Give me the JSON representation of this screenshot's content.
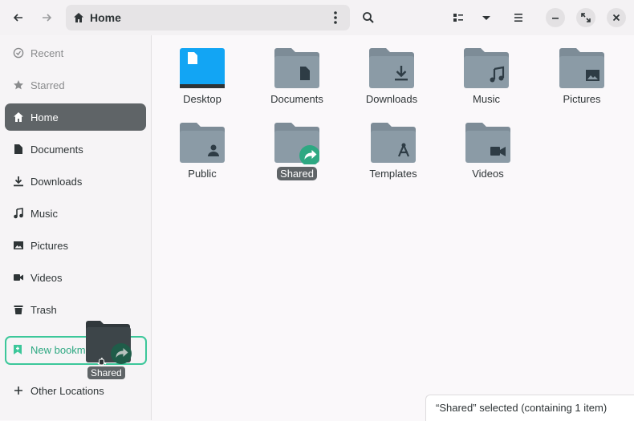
{
  "header": {
    "location": "Home",
    "icons": [
      "back-icon",
      "forward-icon",
      "home-icon",
      "path-menu-icon",
      "search-icon",
      "view-list-icon",
      "sort-dropdown-icon",
      "hamburger-menu-icon",
      "minimize-icon",
      "maximize-icon",
      "close-icon"
    ]
  },
  "sidebar": {
    "items": [
      {
        "label": "Recent",
        "icon": "clock-icon"
      },
      {
        "label": "Starred",
        "icon": "star-icon"
      },
      {
        "label": "Home",
        "icon": "home-icon"
      },
      {
        "label": "Documents",
        "icon": "document-icon"
      },
      {
        "label": "Downloads",
        "icon": "download-icon"
      },
      {
        "label": "Music",
        "icon": "music-icon"
      },
      {
        "label": "Pictures",
        "icon": "picture-icon"
      },
      {
        "label": "Videos",
        "icon": "video-icon"
      },
      {
        "label": "Trash",
        "icon": "trash-icon"
      }
    ],
    "new_bookmark": "New bookm",
    "other_locations": "Other Locations"
  },
  "folders": [
    {
      "label": "Desktop"
    },
    {
      "label": "Documents"
    },
    {
      "label": "Downloads"
    },
    {
      "label": "Music"
    },
    {
      "label": "Pictures"
    },
    {
      "label": "Public"
    },
    {
      "label": "Shared"
    },
    {
      "label": "Templates"
    },
    {
      "label": "Videos"
    }
  ],
  "drag": {
    "label": "Shared"
  },
  "status": {
    "text": "“Shared” selected  (containing 1 item)"
  },
  "colors": {
    "accent": "#3cc79a",
    "folder": "#8b9ba6",
    "folder_back": "#7d8c97",
    "selected": "#5f6467",
    "desktop": "#12a5f4"
  }
}
